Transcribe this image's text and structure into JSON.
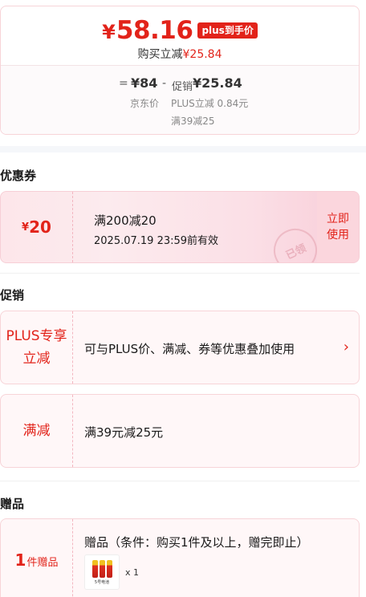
{
  "price_card": {
    "currency": "¥",
    "final_price": "58.16",
    "plus_badge": "plus到手价",
    "buy_prefix": "购买立减",
    "buy_amount": "¥25.84",
    "equals": "=",
    "jd_price": "¥84",
    "minus": "-",
    "promo_label": "促销",
    "promo_amount": "¥25.84",
    "jd_price_label": "京东价",
    "plus_discount": "PLUS立减 0.84元",
    "full_discount": "满39减25"
  },
  "coupon_section": {
    "title": "优惠券",
    "coupon": {
      "currency": "¥",
      "amount": "20",
      "condition": "满200减20",
      "expiry": "2025.07.19 23:59前有效",
      "stamp": "已领",
      "use_line1": "立即",
      "use_line2": "使用"
    }
  },
  "promo_section": {
    "title": "促销",
    "items": [
      {
        "tag_line1": "PLUS专享",
        "tag_line2": "立减",
        "text": "可与PLUS价、满减、券等优惠叠加使用",
        "chevron": "›"
      },
      {
        "tag_line1": "满减",
        "text": "满39元减25元"
      }
    ]
  },
  "gift_section": {
    "title": "赠品",
    "count": "1",
    "count_label": "件赠品",
    "text": "赠品（条件：购买1件及以上，赠完即止）",
    "thumb_label": "5号电池",
    "quantity": "x 1",
    "icon": "battery-pack-icon"
  },
  "colors": {
    "accent": "#e2231a",
    "card_border": "#f7d4d8",
    "card_bg": "#fff7f8"
  }
}
